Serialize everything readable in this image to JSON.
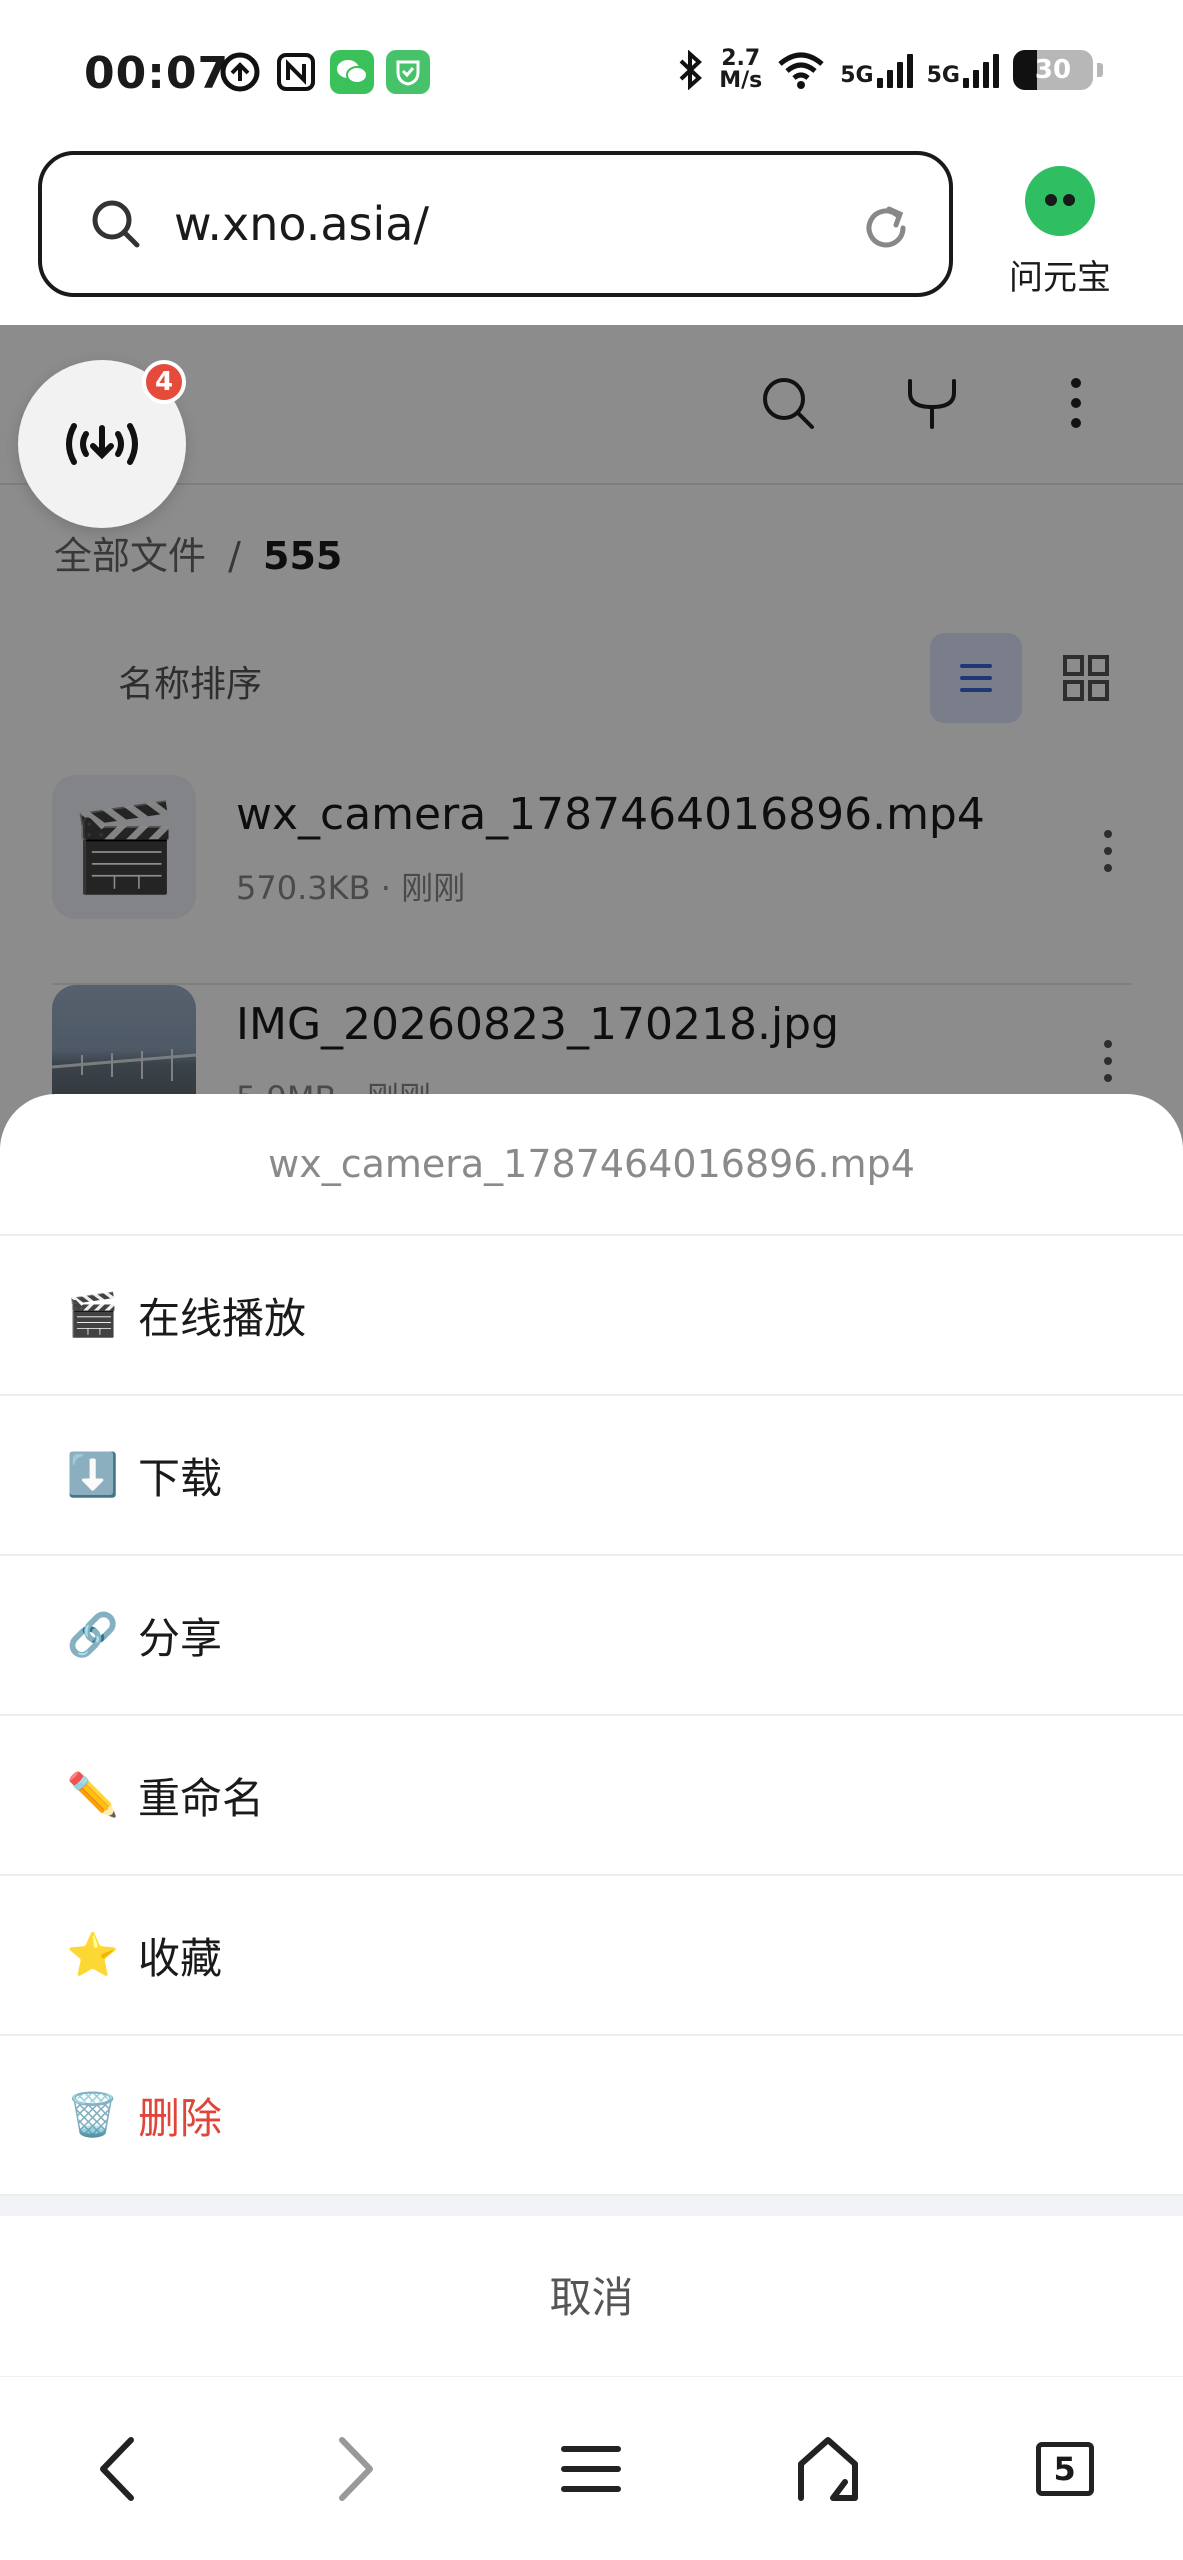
{
  "status_bar": {
    "time": "00:07",
    "net_speed_value": "2.7",
    "net_speed_unit": "M/s",
    "sim1_label": "5G",
    "sim2_label": "5G",
    "battery_level": "30",
    "battery_fraction": 0.3,
    "icons": [
      "browser-icon",
      "nfc-icon",
      "wechat-icon",
      "security-app-icon",
      "bluetooth-icon",
      "wifi-icon"
    ]
  },
  "address_bar": {
    "url": "w.xno.asia/",
    "assistant_label": "问元宝"
  },
  "page": {
    "breadcrumb_root": "全部文件",
    "breadcrumb_separator": "/",
    "breadcrumb_current": "555",
    "sort_label": "名称排序",
    "download_badge_count": "4",
    "files": [
      {
        "name": "wx_camera_1787464016896.mp4",
        "meta": "570.3KB · 刚刚",
        "icon": "🎬"
      },
      {
        "name": "IMG_20260823_170218.jpg",
        "meta": "5.9MB · 刚刚"
      }
    ]
  },
  "action_sheet": {
    "title": "wx_camera_1787464016896.mp4",
    "items": [
      {
        "emoji": "🎬",
        "label": "在线播放"
      },
      {
        "emoji": "⬇️",
        "label": "下载"
      },
      {
        "emoji": "🔗",
        "label": "分享"
      },
      {
        "emoji": "✏️",
        "label": "重命名"
      },
      {
        "emoji": "⭐",
        "label": "收藏"
      },
      {
        "emoji": "🗑️",
        "label": "删除"
      }
    ],
    "cancel_label": "取消",
    "danger_color": "#e0453a"
  },
  "bottom_nav": {
    "tab_count": "5"
  }
}
